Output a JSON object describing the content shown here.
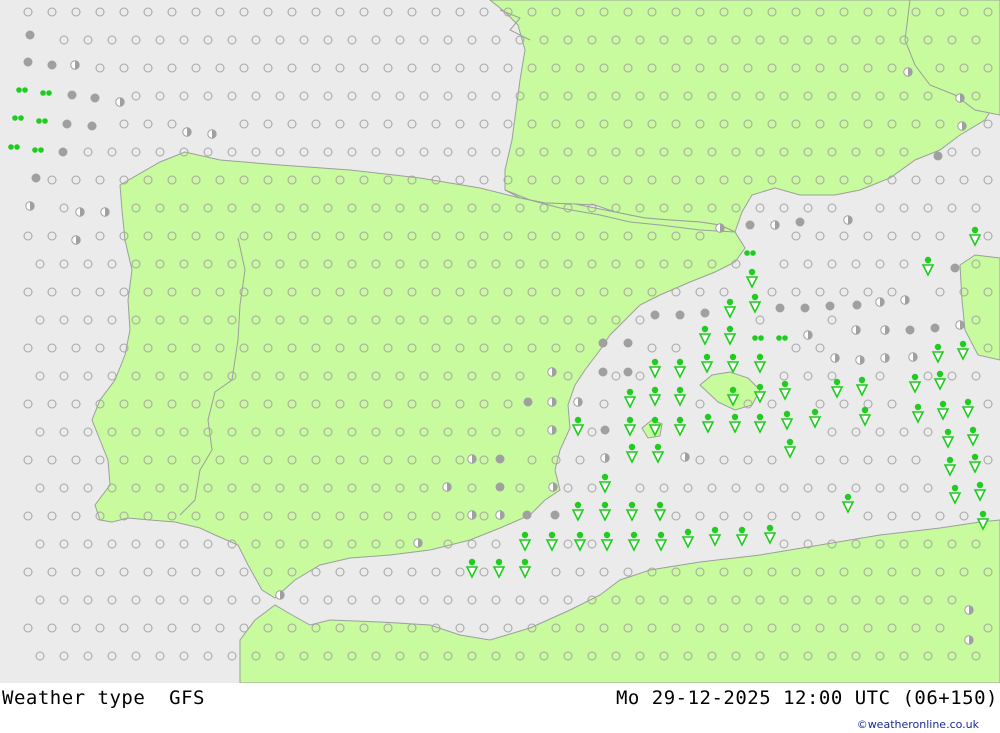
{
  "footer": {
    "title": "Weather type  GFS",
    "date": "Mo 29-12-2025 12:00 UTC (06+150)",
    "credit": "©weatheronline.co.uk"
  },
  "colors": {
    "sea": "#ebebeb",
    "land": "#c8fa9e",
    "coast": "#9aa09a",
    "station_open": "#a5a5a5",
    "station_gray": "#a0a0a0",
    "rain_green": "#1fcc1f"
  },
  "symbol_legend": {
    "open_circle": "no significant weather",
    "gray_dot": "cloudy",
    "half_dot": "partly cloudy",
    "green_double_dot": "drizzle",
    "green_triangle_dot": "rain shower"
  }
}
